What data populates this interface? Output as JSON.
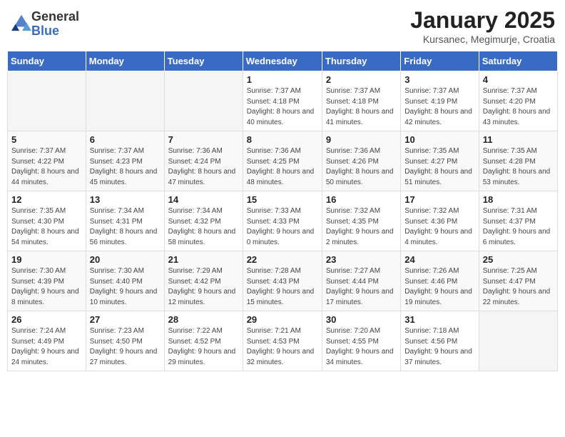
{
  "header": {
    "logo_general": "General",
    "logo_blue": "Blue",
    "month_year": "January 2025",
    "location": "Kursanec, Megimurje, Croatia"
  },
  "weekdays": [
    "Sunday",
    "Monday",
    "Tuesday",
    "Wednesday",
    "Thursday",
    "Friday",
    "Saturday"
  ],
  "weeks": [
    [
      {
        "day": "",
        "sunrise": "",
        "sunset": "",
        "daylight": ""
      },
      {
        "day": "",
        "sunrise": "",
        "sunset": "",
        "daylight": ""
      },
      {
        "day": "",
        "sunrise": "",
        "sunset": "",
        "daylight": ""
      },
      {
        "day": "1",
        "sunrise": "Sunrise: 7:37 AM",
        "sunset": "Sunset: 4:18 PM",
        "daylight": "Daylight: 8 hours and 40 minutes."
      },
      {
        "day": "2",
        "sunrise": "Sunrise: 7:37 AM",
        "sunset": "Sunset: 4:18 PM",
        "daylight": "Daylight: 8 hours and 41 minutes."
      },
      {
        "day": "3",
        "sunrise": "Sunrise: 7:37 AM",
        "sunset": "Sunset: 4:19 PM",
        "daylight": "Daylight: 8 hours and 42 minutes."
      },
      {
        "day": "4",
        "sunrise": "Sunrise: 7:37 AM",
        "sunset": "Sunset: 4:20 PM",
        "daylight": "Daylight: 8 hours and 43 minutes."
      }
    ],
    [
      {
        "day": "5",
        "sunrise": "Sunrise: 7:37 AM",
        "sunset": "Sunset: 4:22 PM",
        "daylight": "Daylight: 8 hours and 44 minutes."
      },
      {
        "day": "6",
        "sunrise": "Sunrise: 7:37 AM",
        "sunset": "Sunset: 4:23 PM",
        "daylight": "Daylight: 8 hours and 45 minutes."
      },
      {
        "day": "7",
        "sunrise": "Sunrise: 7:36 AM",
        "sunset": "Sunset: 4:24 PM",
        "daylight": "Daylight: 8 hours and 47 minutes."
      },
      {
        "day": "8",
        "sunrise": "Sunrise: 7:36 AM",
        "sunset": "Sunset: 4:25 PM",
        "daylight": "Daylight: 8 hours and 48 minutes."
      },
      {
        "day": "9",
        "sunrise": "Sunrise: 7:36 AM",
        "sunset": "Sunset: 4:26 PM",
        "daylight": "Daylight: 8 hours and 50 minutes."
      },
      {
        "day": "10",
        "sunrise": "Sunrise: 7:35 AM",
        "sunset": "Sunset: 4:27 PM",
        "daylight": "Daylight: 8 hours and 51 minutes."
      },
      {
        "day": "11",
        "sunrise": "Sunrise: 7:35 AM",
        "sunset": "Sunset: 4:28 PM",
        "daylight": "Daylight: 8 hours and 53 minutes."
      }
    ],
    [
      {
        "day": "12",
        "sunrise": "Sunrise: 7:35 AM",
        "sunset": "Sunset: 4:30 PM",
        "daylight": "Daylight: 8 hours and 54 minutes."
      },
      {
        "day": "13",
        "sunrise": "Sunrise: 7:34 AM",
        "sunset": "Sunset: 4:31 PM",
        "daylight": "Daylight: 8 hours and 56 minutes."
      },
      {
        "day": "14",
        "sunrise": "Sunrise: 7:34 AM",
        "sunset": "Sunset: 4:32 PM",
        "daylight": "Daylight: 8 hours and 58 minutes."
      },
      {
        "day": "15",
        "sunrise": "Sunrise: 7:33 AM",
        "sunset": "Sunset: 4:33 PM",
        "daylight": "Daylight: 9 hours and 0 minutes."
      },
      {
        "day": "16",
        "sunrise": "Sunrise: 7:32 AM",
        "sunset": "Sunset: 4:35 PM",
        "daylight": "Daylight: 9 hours and 2 minutes."
      },
      {
        "day": "17",
        "sunrise": "Sunrise: 7:32 AM",
        "sunset": "Sunset: 4:36 PM",
        "daylight": "Daylight: 9 hours and 4 minutes."
      },
      {
        "day": "18",
        "sunrise": "Sunrise: 7:31 AM",
        "sunset": "Sunset: 4:37 PM",
        "daylight": "Daylight: 9 hours and 6 minutes."
      }
    ],
    [
      {
        "day": "19",
        "sunrise": "Sunrise: 7:30 AM",
        "sunset": "Sunset: 4:39 PM",
        "daylight": "Daylight: 9 hours and 8 minutes."
      },
      {
        "day": "20",
        "sunrise": "Sunrise: 7:30 AM",
        "sunset": "Sunset: 4:40 PM",
        "daylight": "Daylight: 9 hours and 10 minutes."
      },
      {
        "day": "21",
        "sunrise": "Sunrise: 7:29 AM",
        "sunset": "Sunset: 4:42 PM",
        "daylight": "Daylight: 9 hours and 12 minutes."
      },
      {
        "day": "22",
        "sunrise": "Sunrise: 7:28 AM",
        "sunset": "Sunset: 4:43 PM",
        "daylight": "Daylight: 9 hours and 15 minutes."
      },
      {
        "day": "23",
        "sunrise": "Sunrise: 7:27 AM",
        "sunset": "Sunset: 4:44 PM",
        "daylight": "Daylight: 9 hours and 17 minutes."
      },
      {
        "day": "24",
        "sunrise": "Sunrise: 7:26 AM",
        "sunset": "Sunset: 4:46 PM",
        "daylight": "Daylight: 9 hours and 19 minutes."
      },
      {
        "day": "25",
        "sunrise": "Sunrise: 7:25 AM",
        "sunset": "Sunset: 4:47 PM",
        "daylight": "Daylight: 9 hours and 22 minutes."
      }
    ],
    [
      {
        "day": "26",
        "sunrise": "Sunrise: 7:24 AM",
        "sunset": "Sunset: 4:49 PM",
        "daylight": "Daylight: 9 hours and 24 minutes."
      },
      {
        "day": "27",
        "sunrise": "Sunrise: 7:23 AM",
        "sunset": "Sunset: 4:50 PM",
        "daylight": "Daylight: 9 hours and 27 minutes."
      },
      {
        "day": "28",
        "sunrise": "Sunrise: 7:22 AM",
        "sunset": "Sunset: 4:52 PM",
        "daylight": "Daylight: 9 hours and 29 minutes."
      },
      {
        "day": "29",
        "sunrise": "Sunrise: 7:21 AM",
        "sunset": "Sunset: 4:53 PM",
        "daylight": "Daylight: 9 hours and 32 minutes."
      },
      {
        "day": "30",
        "sunrise": "Sunrise: 7:20 AM",
        "sunset": "Sunset: 4:55 PM",
        "daylight": "Daylight: 9 hours and 34 minutes."
      },
      {
        "day": "31",
        "sunrise": "Sunrise: 7:18 AM",
        "sunset": "Sunset: 4:56 PM",
        "daylight": "Daylight: 9 hours and 37 minutes."
      },
      {
        "day": "",
        "sunrise": "",
        "sunset": "",
        "daylight": ""
      }
    ]
  ]
}
